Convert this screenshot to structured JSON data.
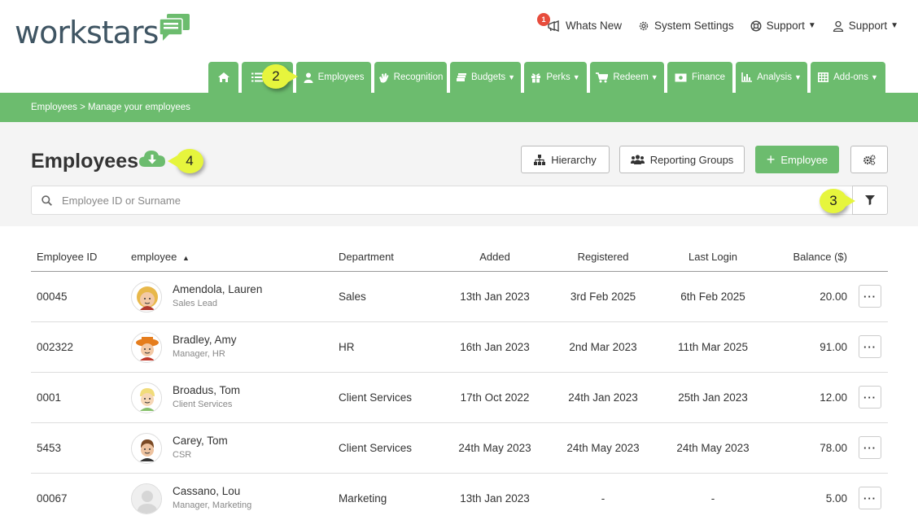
{
  "brand": {
    "name": "workstars",
    "color": "#3f5563",
    "accent": "#6cbc6e"
  },
  "topnav": {
    "whats_new": {
      "label": "Whats New",
      "badge": "1"
    },
    "system_settings": "System Settings",
    "support_1": "Support",
    "support_2": "Support"
  },
  "tabs": {
    "home": "home-icon",
    "list": "list-icon",
    "employees": "Employees",
    "recognition": "Recognition",
    "budgets": "Budgets",
    "perks": "Perks",
    "redeem": "Redeem",
    "finance": "Finance",
    "analysis": "Analysis",
    "addons": "Add-ons"
  },
  "breadcrumb": "Employees > Manage your employees",
  "page": {
    "title": "Employees",
    "hierarchy_label": "Hierarchy",
    "reporting_groups_label": "Reporting Groups",
    "add_employee_label": "Employee",
    "search_placeholder": "Employee ID or Surname"
  },
  "callouts": {
    "c2": "2",
    "c3": "3",
    "c4": "4"
  },
  "table": {
    "headers": {
      "id": "Employee ID",
      "employee": "employee",
      "department": "Department",
      "added": "Added",
      "registered": "Registered",
      "last_login": "Last Login",
      "balance": "Balance ($)"
    },
    "rows": [
      {
        "id": "00045",
        "name": "Amendola, Lauren",
        "role": "Sales Lead",
        "department": "Sales",
        "added": "13th Jan 2023",
        "registered": "3rd Feb 2025",
        "last_login": "6th Feb 2025",
        "balance": "20.00"
      },
      {
        "id": "002322",
        "name": "Bradley, Amy",
        "role": "Manager, HR",
        "department": "HR",
        "added": "16th Jan 2023",
        "registered": "2nd Mar 2023",
        "last_login": "11th Mar 2025",
        "balance": "91.00"
      },
      {
        "id": "0001",
        "name": "Broadus, Tom",
        "role": "Client Services",
        "department": "Client Services",
        "added": "17th Oct 2022",
        "registered": "24th Jan 2023",
        "last_login": "25th Jan 2023",
        "balance": "12.00"
      },
      {
        "id": "5453",
        "name": "Carey, Tom",
        "role": "CSR",
        "department": "Client Services",
        "added": "24th May 2023",
        "registered": "24th May 2023",
        "last_login": "24th May 2023",
        "balance": "78.00"
      },
      {
        "id": "00067",
        "name": "Cassano, Lou",
        "role": "Manager, Marketing",
        "department": "Marketing",
        "added": "13th Jan 2023",
        "registered": "-",
        "last_login": "-",
        "balance": "5.00"
      }
    ]
  }
}
